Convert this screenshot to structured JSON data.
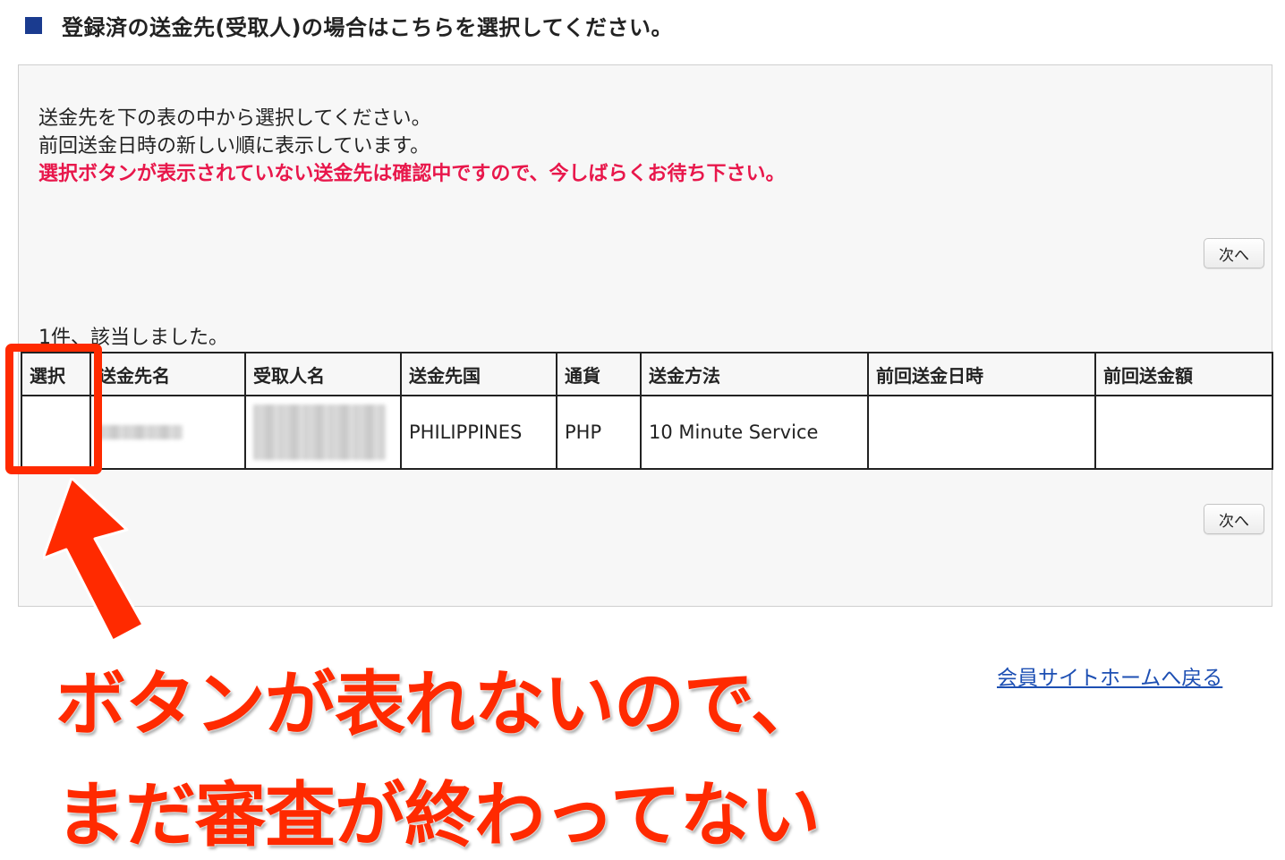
{
  "heading": {
    "text": "登録済の送金先(受取人)の場合はこちらを選択してください。"
  },
  "instructions": {
    "line1": "送金先を下の表の中から選択してください。",
    "line2": "前回送金日時の新しい順に表示しています。",
    "warning": "選択ボタンが表示されていない送金先は確認中ですので、今しばらくお待ち下さい。"
  },
  "pagination": {
    "next_label": "次へ"
  },
  "results": {
    "count_text": "1件、該当しました。"
  },
  "table": {
    "headers": [
      "選択",
      "送金先名",
      "受取人名",
      "送金先国",
      "通貨",
      "送金方法",
      "前回送金日時",
      "前回送金額"
    ],
    "rows": [
      {
        "select": "",
        "destination_name": "",
        "recipient_name": "",
        "country": "PHILIPPINES",
        "currency": "PHP",
        "method": "10 Minute Service",
        "last_date": "",
        "last_amount": ""
      }
    ]
  },
  "annotation": {
    "line1": "ボタンが表れないので、",
    "line2": "まだ審査が終わってない"
  },
  "home_link": {
    "label": "会員サイトホームへ戻る"
  },
  "colors": {
    "warning": "#e8174b",
    "annotation": "#ff2a00",
    "heading_square": "#1a3b8f",
    "link": "#1d4fb3"
  }
}
